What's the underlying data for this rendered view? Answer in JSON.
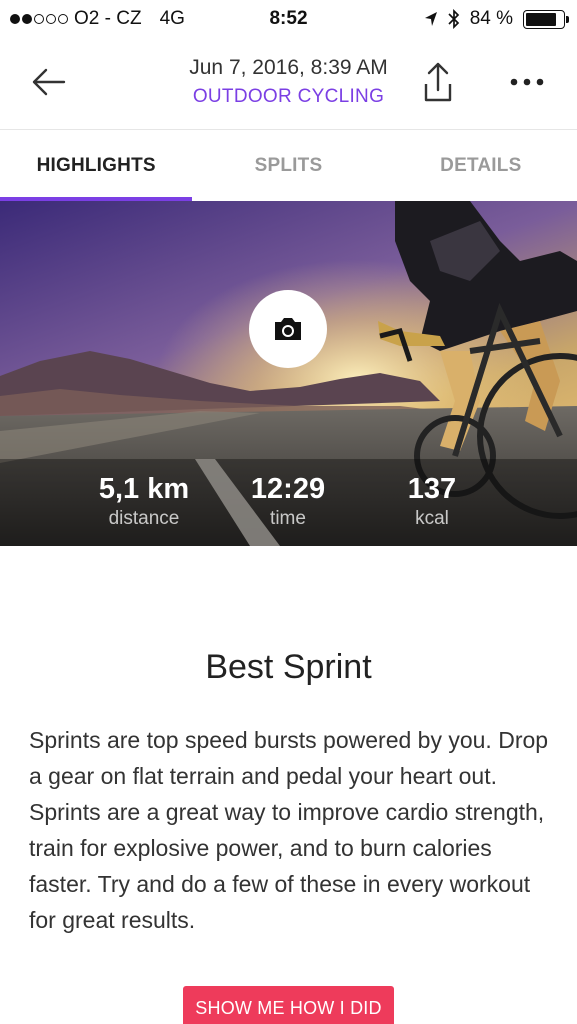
{
  "status_bar": {
    "carrier": "O2 - CZ",
    "network": "4G",
    "time": "8:52",
    "battery_percent": "84 %",
    "battery_level": 0.84
  },
  "header": {
    "date": "Jun 7, 2016, 8:39 AM",
    "activity_type": "OUTDOOR CYCLING",
    "accent_color": "#7b3fe4"
  },
  "tabs": [
    {
      "label": "HIGHLIGHTS",
      "active": true
    },
    {
      "label": "SPLITS",
      "active": false
    },
    {
      "label": "DETAILS",
      "active": false
    }
  ],
  "stats": [
    {
      "value": "5,1 km",
      "label": "distance"
    },
    {
      "value": "12:29",
      "label": "time"
    },
    {
      "value": "137",
      "label": "kcal"
    }
  ],
  "highlight": {
    "title": "Best Sprint",
    "description": "Sprints are top speed bursts powered by you. Drop a gear on flat terrain and pedal your heart out. Sprints are a great way to improve cardio strength, train for explosive power, and to burn calories faster. Try and do a few of these in every workout for great results.",
    "cta_label": "SHOW ME HOW I DID",
    "cta_color": "#ee3b5b"
  },
  "icons": [
    "back-arrow-icon",
    "share-icon",
    "more-icon",
    "camera-icon",
    "location-icon",
    "bluetooth-icon",
    "battery-icon"
  ]
}
